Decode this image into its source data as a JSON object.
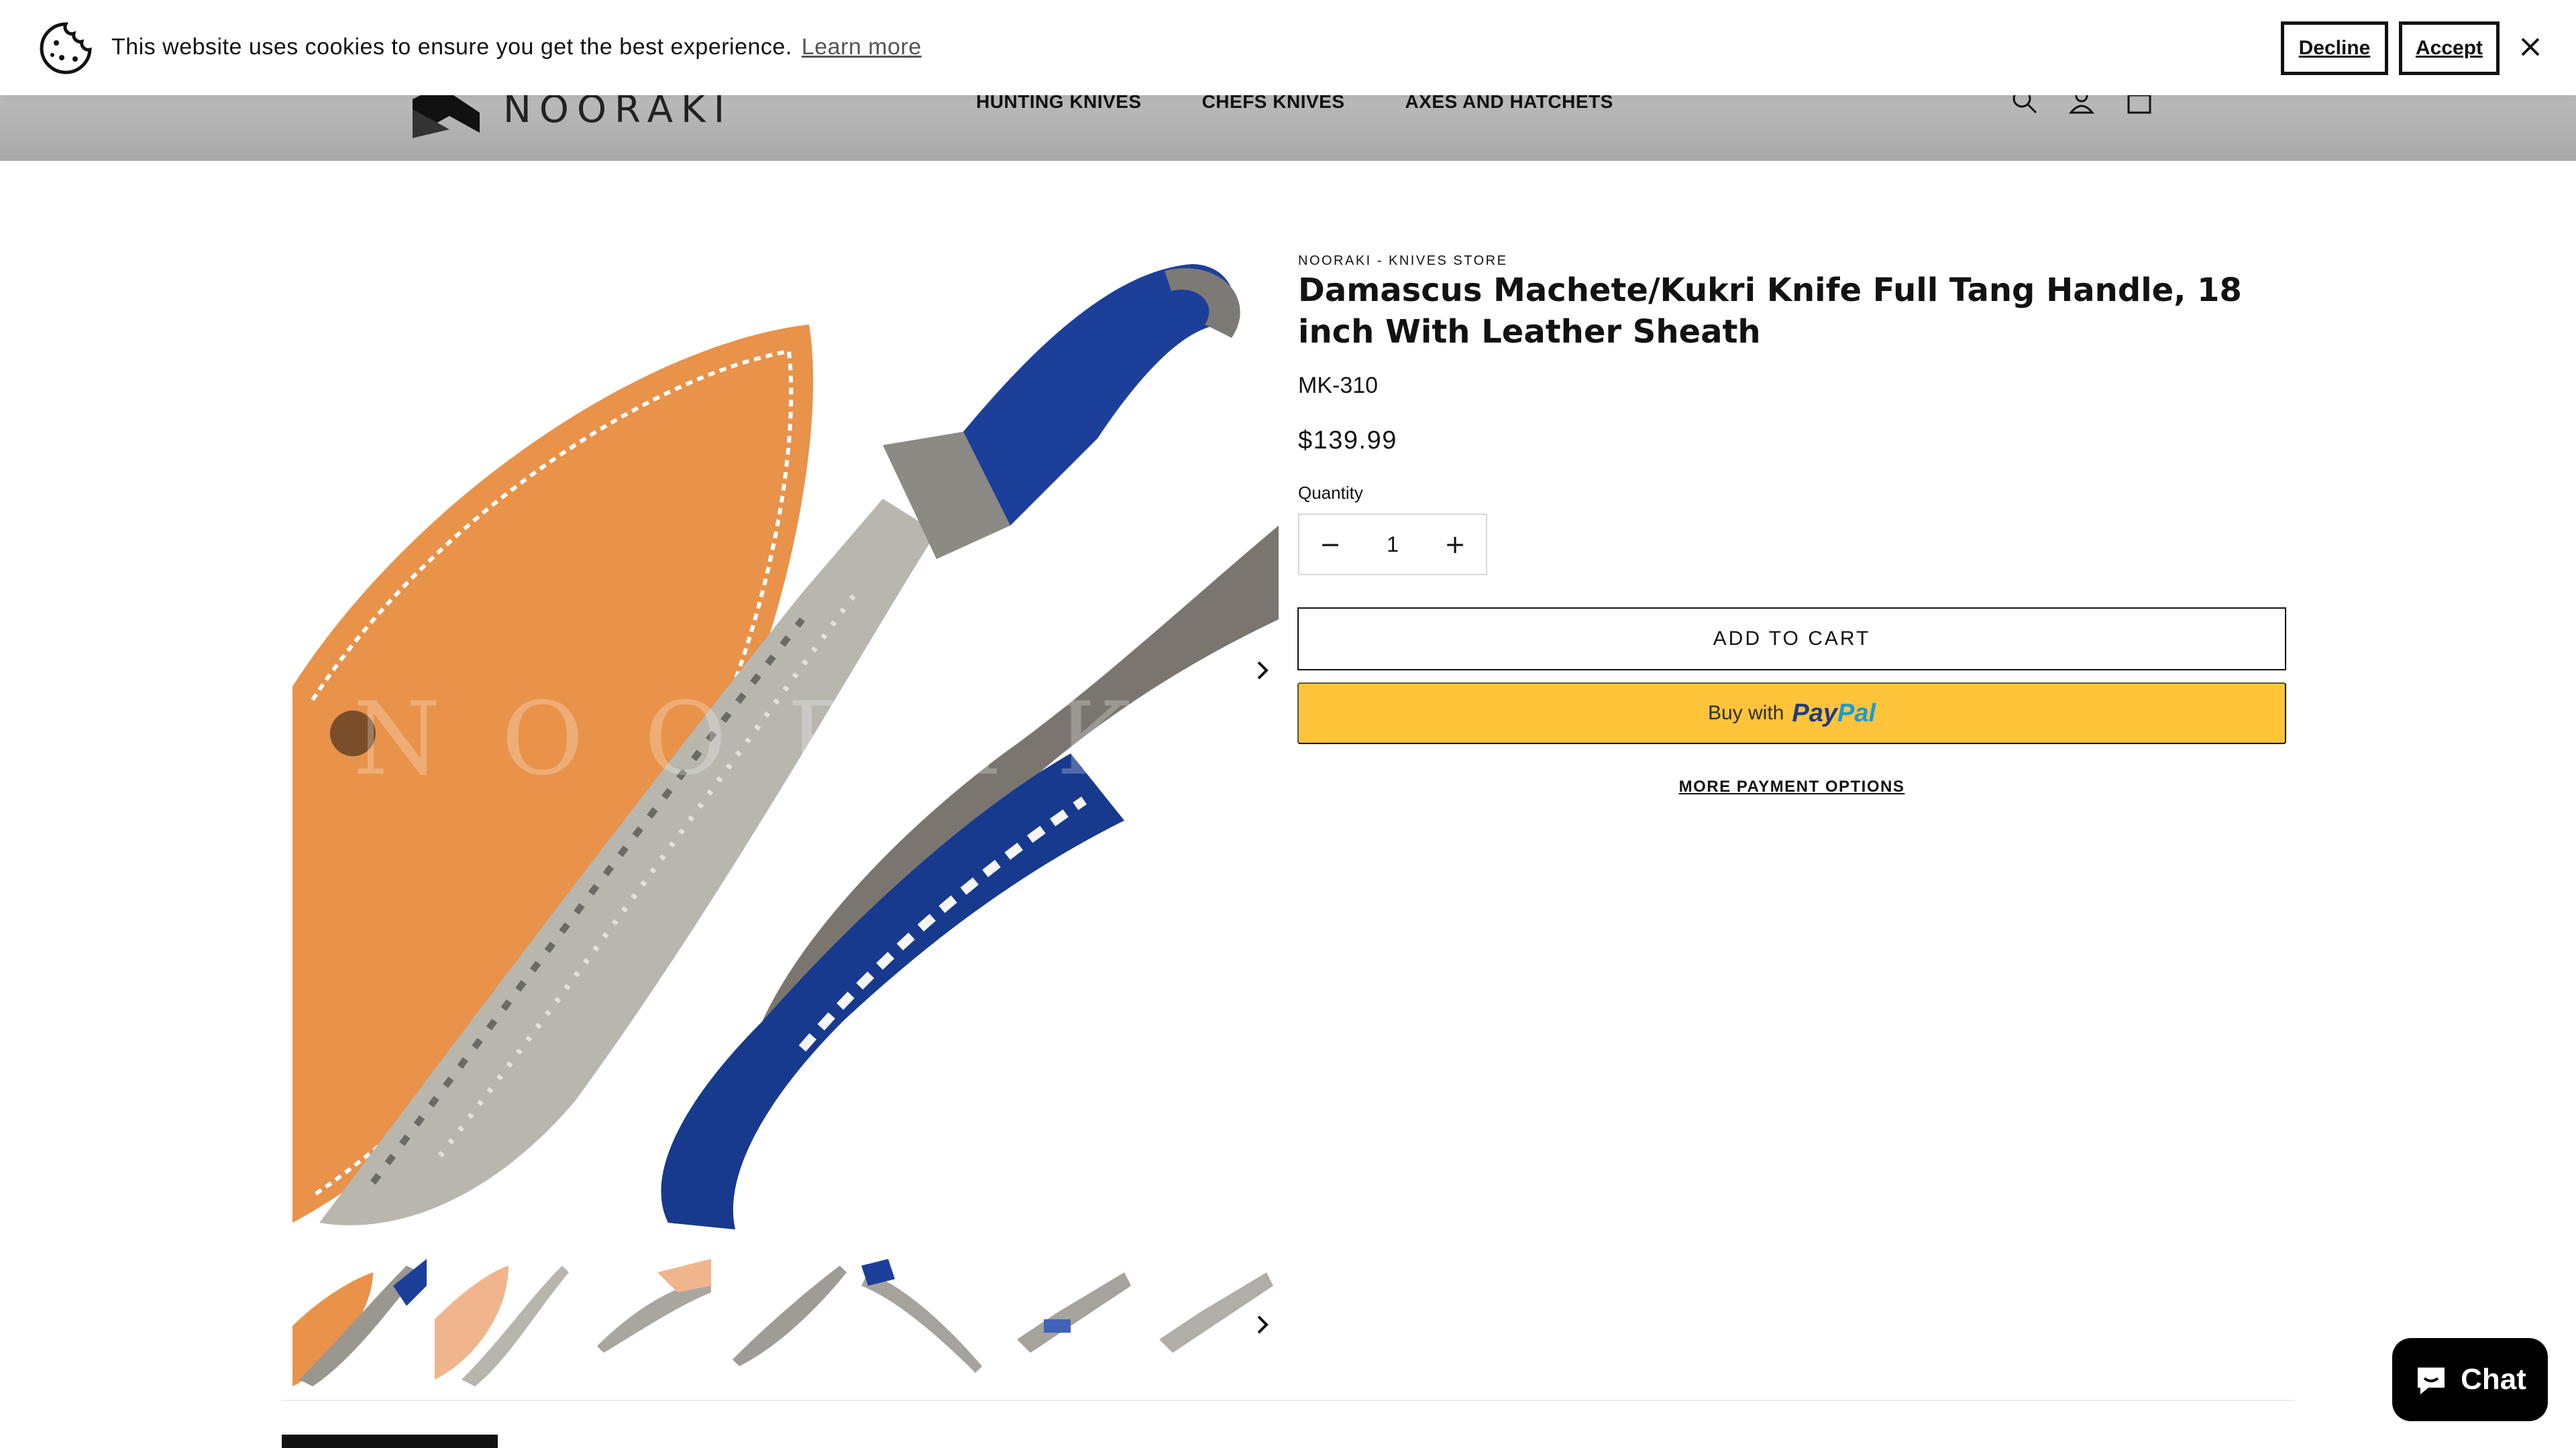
{
  "cookie_banner": {
    "message": "This website uses cookies to ensure you get the best experience.",
    "learn_more": "Learn more",
    "decline": "Decline",
    "accept": "Accept",
    "icon": "cookie-icon"
  },
  "header": {
    "logo_text": "NOORAKI",
    "nav": [
      "HUNTING KNIVES",
      "CHEFS KNIVES",
      "AXES AND HATCHETS"
    ],
    "icons": [
      "search-icon",
      "account-icon",
      "cart-icon"
    ]
  },
  "gallery": {
    "watermark": "NOORAKI",
    "thumbnail_count": 7
  },
  "product": {
    "vendor": "NOORAKI - KNIVES STORE",
    "title": "Damascus Machete/Kukri Knife Full Tang Handle, 18 inch With Leather Sheath",
    "sku": "MK-310",
    "price": "$139.99",
    "quantity_label": "Quantity",
    "quantity": "1",
    "add_to_cart": "ADD TO CART",
    "paypal_buy": "Buy with",
    "paypal_brand_1": "Pay",
    "paypal_brand_2": "Pal",
    "more_payment": "MORE PAYMENT OPTIONS"
  },
  "chat": {
    "label": "Chat"
  },
  "colors": {
    "paypal_yellow": "#ffc439",
    "leather": "#e8924a",
    "handle_blue": "#1c3f9a"
  }
}
